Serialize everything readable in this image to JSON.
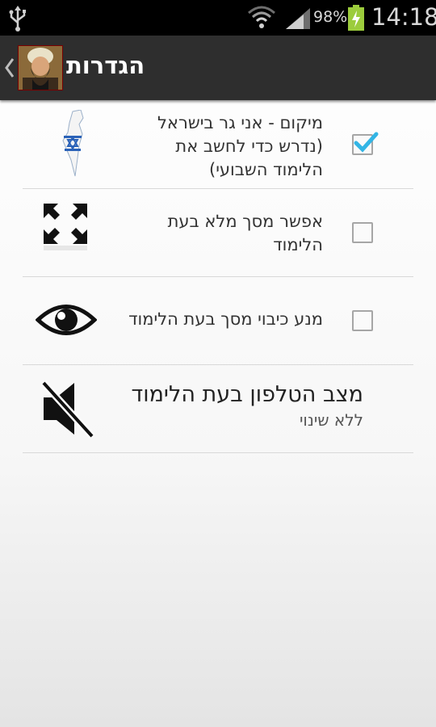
{
  "status_bar": {
    "battery_percent": "98%",
    "time": "14:18",
    "icons": [
      "usb-icon",
      "wifi-icon",
      "signal-icon",
      "battery-charging-icon"
    ]
  },
  "action_bar": {
    "title": "הגדרות",
    "up_icon": "chevron-left-icon",
    "app_icon": "rabbi-portrait-avatar"
  },
  "settings": [
    {
      "label_lines": [
        "מיקום - אני גר בישראל",
        "(נדרש כדי לחשב את",
        "הלימוד השבועי)"
      ],
      "icon": "israel-map-icon",
      "checked": true
    },
    {
      "label_lines": [
        "אפשר מסך מלא בעת",
        "הלימוד"
      ],
      "icon": "fullscreen-icon",
      "checked": false
    },
    {
      "label_lines": [
        "מנע כיבוי מסך בעת הלימוד"
      ],
      "icon": "eye-icon",
      "checked": false
    },
    {
      "title": "מצב הטלפון בעת הלימוד",
      "summary": "ללא שינוי",
      "icon": "speaker-muted-icon"
    }
  ],
  "colors": {
    "status_bar_bg": "#000000",
    "action_bar_bg": "#2e2e2e",
    "checkmark": "#33b5e5",
    "divider": "#d8d8d8"
  }
}
